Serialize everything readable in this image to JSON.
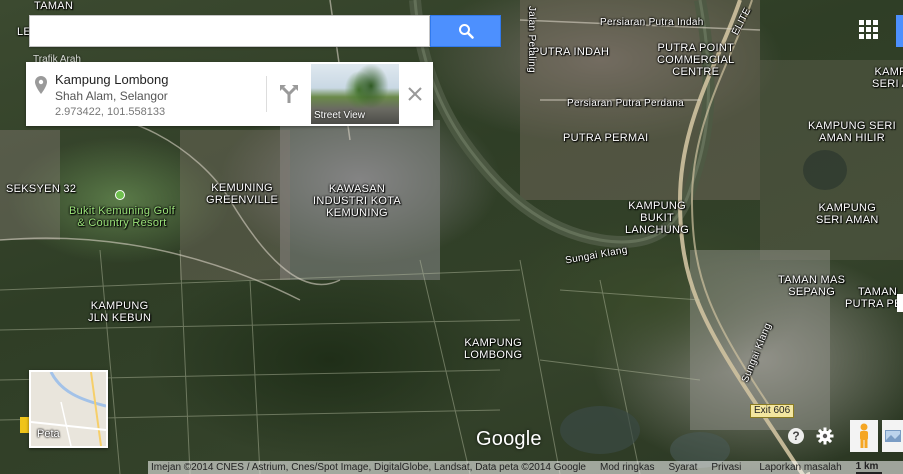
{
  "search": {
    "value": "",
    "placeholder": "",
    "partial_hint": "Trafik  Arah"
  },
  "place_card": {
    "title": "Kampung Lombong",
    "subtitle": "Shah Alam, Selangor",
    "coordinates": "2.973422, 101.558133",
    "streetview_label": "Street View"
  },
  "map_labels": [
    {
      "text": "TAMAN",
      "class": ""
    },
    {
      "text": "LE",
      "class": ""
    },
    {
      "text": "PUTRA INDAH",
      "class": ""
    },
    {
      "text": "Persiaran Putra Indah",
      "class": "road"
    },
    {
      "text": "PUTRA POINT\nCOMMERCIAL\nCENTRE",
      "class": ""
    },
    {
      "text": "Persiaran Putra Perdana",
      "class": "road"
    },
    {
      "text": "PUTRA PERMAI",
      "class": ""
    },
    {
      "text": "KAMPUNG SERI\nAMAN HILIR",
      "class": ""
    },
    {
      "text": "KAMPUNG\nSERI AMAN",
      "class": ""
    },
    {
      "text": "KAMP\nSERI A",
      "class": ""
    },
    {
      "text": "SEKSYEN 32",
      "class": ""
    },
    {
      "text": "KEMUNING\nGREENVILLE",
      "class": ""
    },
    {
      "text": "KAWASAN\nINDUSTRI KOTA\nKEMUNING",
      "class": ""
    },
    {
      "text": "Bukit Kemuning Golf\n& Country Resort",
      "class": "green"
    },
    {
      "text": "KAMPUNG\nBUKIT\nLANCHUNG",
      "class": ""
    },
    {
      "text": "KAMPUNG\nJLN KEBUN",
      "class": ""
    },
    {
      "text": "KAMPUNG\nLOMBONG",
      "class": ""
    },
    {
      "text": "TAMAN MAS\nSEPANG",
      "class": ""
    },
    {
      "text": "TAMAN\nPUTRA PER",
      "class": ""
    },
    {
      "text": "Sungai Klang",
      "class": "road"
    },
    {
      "text": "Sungai Klang",
      "class": "road"
    },
    {
      "text": "Jalan Petaling",
      "class": "road"
    },
    {
      "text": "ELITE",
      "class": "road"
    }
  ],
  "exit_sign": "Exit 606",
  "minimap": {
    "label": "Peta"
  },
  "logo": "Google",
  "footer": {
    "attribution": "Imejan ©2014 CNES / Astrium, Cnes/Spot Image, DigitalGlobe, Landsat, Data peta ©2014 Google",
    "shortcuts": "Mod ringkas",
    "terms": "Syarat",
    "privacy": "Privasi",
    "report": "Laporkan masalah",
    "scale": "1 km"
  },
  "icons": {
    "search": "search-icon",
    "pin": "location-pin-icon",
    "directions": "directions-icon",
    "close": "close-icon",
    "apps": "apps-grid-icon",
    "help": "help-icon",
    "settings": "gear-icon",
    "pegman": "pegman-icon",
    "imagery": "imagery-icon"
  },
  "colors": {
    "search_button": "#4d90fe",
    "label_text": "#ffffff",
    "golf_label": "#9be37a"
  }
}
